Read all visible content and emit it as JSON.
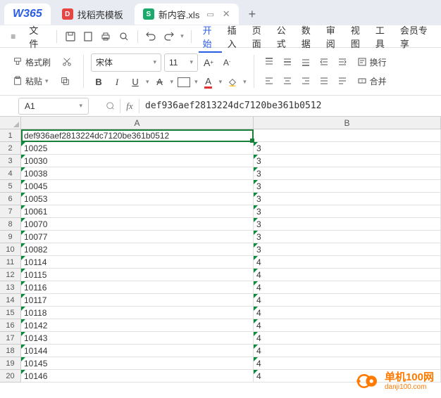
{
  "tabs": {
    "home_logo": "W365",
    "template": {
      "label": "找稻壳模板",
      "icon_bg": "#e64545",
      "icon_text": "D"
    },
    "file": {
      "label": "新内容.xls",
      "icon_bg": "#1aab6c",
      "icon_text": "S"
    },
    "new": "+"
  },
  "menubar": {
    "file": "文件",
    "items": [
      "开始",
      "插入",
      "页面",
      "公式",
      "数据",
      "审阅",
      "视图",
      "工具",
      "会员专享"
    ],
    "active_index": 0
  },
  "toolbar": {
    "format_painter": "格式刷",
    "paste": "粘贴",
    "font_name": "宋体",
    "font_size": "11",
    "increase_font": "A⁺",
    "decrease_font": "A⁻",
    "bold": "B",
    "italic": "I",
    "underline": "U",
    "strike": "A",
    "wrap": "换行",
    "merge": "合并"
  },
  "formula_bar": {
    "cell_ref": "A1",
    "fx": "fx",
    "value": "def936aef2813224dc7120be361b0512"
  },
  "grid": {
    "columns": [
      "A",
      "B"
    ],
    "rows": [
      {
        "n": "1",
        "a": "def936aef2813224dc7120be361b0512",
        "b": "",
        "err": false
      },
      {
        "n": "2",
        "a": "10025",
        "b": "3",
        "err": true
      },
      {
        "n": "3",
        "a": "10030",
        "b": "3",
        "err": true
      },
      {
        "n": "4",
        "a": "10038",
        "b": "3",
        "err": true
      },
      {
        "n": "5",
        "a": "10045",
        "b": "3",
        "err": true
      },
      {
        "n": "6",
        "a": "10053",
        "b": "3",
        "err": true
      },
      {
        "n": "7",
        "a": "10061",
        "b": "3",
        "err": true
      },
      {
        "n": "8",
        "a": "10070",
        "b": "3",
        "err": true
      },
      {
        "n": "9",
        "a": "10077",
        "b": "3",
        "err": true
      },
      {
        "n": "10",
        "a": "10082",
        "b": "3",
        "err": true
      },
      {
        "n": "11",
        "a": "10114",
        "b": "4",
        "err": true
      },
      {
        "n": "12",
        "a": "10115",
        "b": "4",
        "err": true
      },
      {
        "n": "13",
        "a": "10116",
        "b": "4",
        "err": true
      },
      {
        "n": "14",
        "a": "10117",
        "b": "4",
        "err": true
      },
      {
        "n": "15",
        "a": "10118",
        "b": "4",
        "err": true
      },
      {
        "n": "16",
        "a": "10142",
        "b": "4",
        "err": true
      },
      {
        "n": "17",
        "a": "10143",
        "b": "4",
        "err": true
      },
      {
        "n": "18",
        "a": "10144",
        "b": "4",
        "err": true
      },
      {
        "n": "19",
        "a": "10145",
        "b": "4",
        "err": true
      },
      {
        "n": "20",
        "a": "10146",
        "b": "4",
        "err": true
      }
    ]
  },
  "watermark": {
    "main": "单机100网",
    "sub": "danji100.com"
  }
}
